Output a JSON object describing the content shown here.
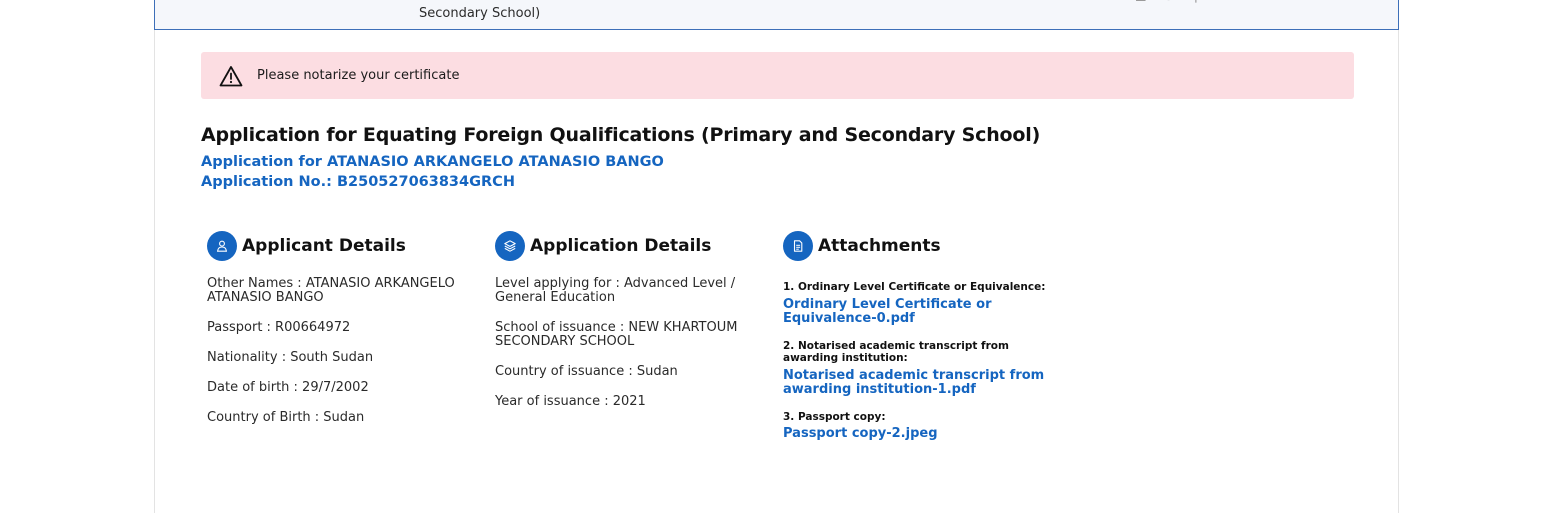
{
  "header": {
    "title_tail": "Secondary School)"
  },
  "alert": {
    "icon": "warning-icon",
    "message": "Please notarize your certificate"
  },
  "application": {
    "title": "Application for Equating Foreign Qualifications (Primary and Secondary School)",
    "applicant_line": "Application for ATANASIO ARKANGELO ATANASIO BANGO",
    "number_line": "Application No.: B250527063834GRCH"
  },
  "applicant_details": {
    "icon": "user-icon",
    "heading": "Applicant Details",
    "items": [
      "Other Names : ATANASIO ARKANGELO ATANASIO BANGO",
      "Passport : R00664972",
      "Nationality : South Sudan",
      "Date of birth : 29/7/2002",
      "Country of Birth : Sudan"
    ]
  },
  "application_details": {
    "icon": "layers-icon",
    "heading": "Application Details",
    "items": [
      "Level applying for : Advanced Level / General Education",
      "School of issuance : NEW KHARTOUM SECONDARY SCHOOL",
      "Country of issuance : Sudan",
      "Year of issuance : 2021"
    ]
  },
  "attachments": {
    "icon": "document-icon",
    "heading": "Attachments",
    "items": [
      {
        "label": "1. Ordinary Level Certificate or Equivalence:",
        "file": "Ordinary Level Certificate or Equivalence-0.pdf"
      },
      {
        "label": "2. Notarised academic transcript from awarding institution:",
        "file": "Notarised academic transcript from awarding institution-1.pdf"
      },
      {
        "label": "3. Passport copy:",
        "file": "Passport copy-2.jpeg"
      }
    ]
  },
  "colors": {
    "accent": "#1565c0",
    "alert_bg": "#fcdde2"
  }
}
